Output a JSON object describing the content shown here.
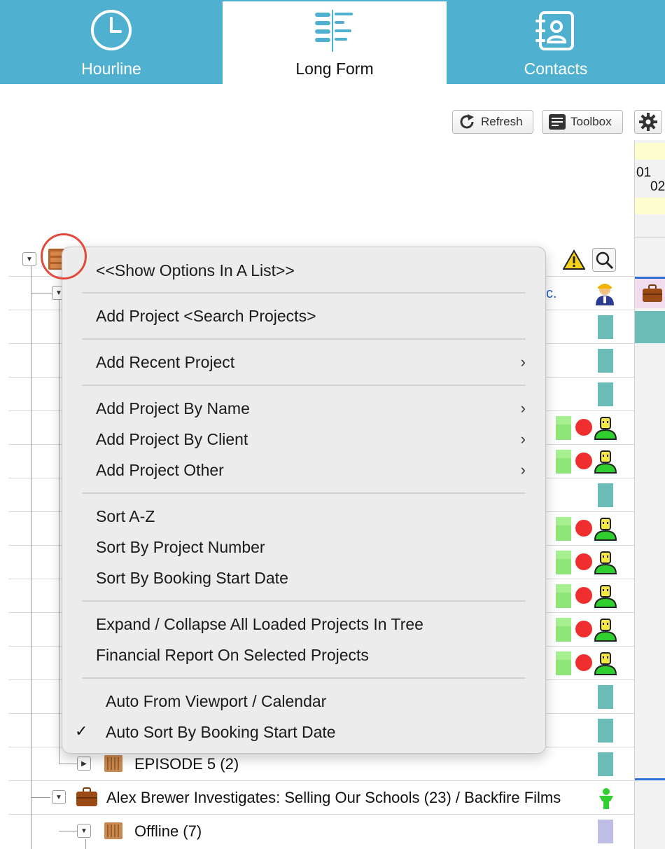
{
  "tabs": [
    {
      "label": "Hourline",
      "icon": "clock-icon",
      "active": false
    },
    {
      "label": "Long Form",
      "icon": "timeline-icon",
      "active": true
    },
    {
      "label": "Contacts",
      "icon": "contacts-book-icon",
      "active": false
    }
  ],
  "toolbar": {
    "refresh_label": "Refresh",
    "toolbox_label": "Toolbox",
    "settings_icon": "gear-icon"
  },
  "calendar": {
    "day_top": "01",
    "day_bottom": "02"
  },
  "context_menu": {
    "items": [
      {
        "label": "<<Show Options In A List>>"
      },
      {
        "label": "Add Project <Search Projects>"
      },
      {
        "label": "Add Recent Project",
        "submenu": true
      },
      {
        "label": "Add Project By Name",
        "submenu": true
      },
      {
        "label": "Add Project By Client",
        "submenu": true
      },
      {
        "label": "Add Project Other",
        "submenu": true
      },
      {
        "label": "Sort A-Z"
      },
      {
        "label": "Sort By Project Number"
      },
      {
        "label": "Sort By Booking Start Date"
      },
      {
        "label": "Expand / Collapse All Loaded Projects In Tree"
      },
      {
        "label": "Financial Report On Selected Projects"
      },
      {
        "label": "Auto From Viewport / Calendar",
        "checked": false
      },
      {
        "label": "Auto Sort By Booking Start Date",
        "checked": true
      }
    ],
    "chevron": "›",
    "checkmark": "✓"
  },
  "tree": {
    "partial_row_text": "c.",
    "rows": [
      {
        "label": "EPISODE 5 (2)",
        "icon": "film-folder-icon"
      },
      {
        "label": "Alex Brewer Investigates: Selling Our Schools (23) / Backfire Films",
        "icon": "briefcase-icon"
      },
      {
        "label": "Offline (7)",
        "icon": "film-folder-icon"
      }
    ]
  },
  "colors": {
    "tab_bar": "#4fb1cf",
    "teal_booking": "#6bbbb6",
    "green_booking": "#8fe678",
    "red_status": "#ef2f2f",
    "lilac_booking": "#bdbde6",
    "highlight_circle": "#e24a3b"
  }
}
